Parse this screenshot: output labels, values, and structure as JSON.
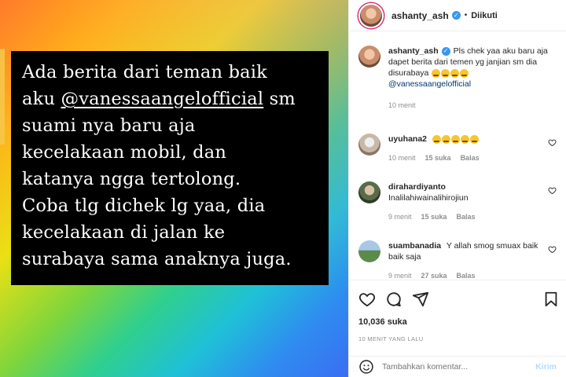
{
  "story": {
    "line1": "Ada berita dari teman baik",
    "line2_prefix": "aku ",
    "line2_mention": "@vanessaangelofficial",
    "line2_suffix": " sm",
    "line3": "suami nya baru aja",
    "line4": "kecelakaan mobil, dan",
    "line5": "katanya ngga tertolong.",
    "line6": "Coba tlg dichek lg yaa, dia",
    "line7": "kecelakaan di jalan ke",
    "line8": "surabaya sama anaknya juga."
  },
  "header": {
    "username": "ashanty_ash",
    "dot": "•",
    "follow_status": "Diikuti"
  },
  "caption": {
    "username": "ashanty_ash",
    "text": "Pls chek yaa aku baru aja dapet berita dari temen yg janjian sm dia disurabaya",
    "mention": "@vanessaangelofficial",
    "time": "10 menit"
  },
  "comments": [
    {
      "username": "uyuhana2",
      "text": "",
      "time": "10 menit",
      "likes": "15 suka",
      "reply": "Balas"
    },
    {
      "username": "dirahardiyanto",
      "text": "Inalilahiwainalihirojiun",
      "time": "9 menit",
      "likes": "15 suka",
      "reply": "Balas"
    },
    {
      "username": "suambanadia",
      "text": "Y allah smog smuax baik baik saja",
      "time": "9 menit",
      "likes": "27 suka",
      "reply": "Balas"
    }
  ],
  "likes_count": "10,036 suka",
  "posted_time": "10 MENIT YANG LALU",
  "add_comment": {
    "placeholder": "Tambahkan komentar...",
    "post_label": "Kirim"
  },
  "colors": {
    "link": "#00376b",
    "verified": "#3897f0",
    "muted": "#8e8e8e",
    "post_button_disabled": "#b3dbff"
  },
  "icons": [
    "heart-icon",
    "comment-icon",
    "share-icon",
    "bookmark-icon",
    "emoji-icon",
    "verified-icon"
  ]
}
